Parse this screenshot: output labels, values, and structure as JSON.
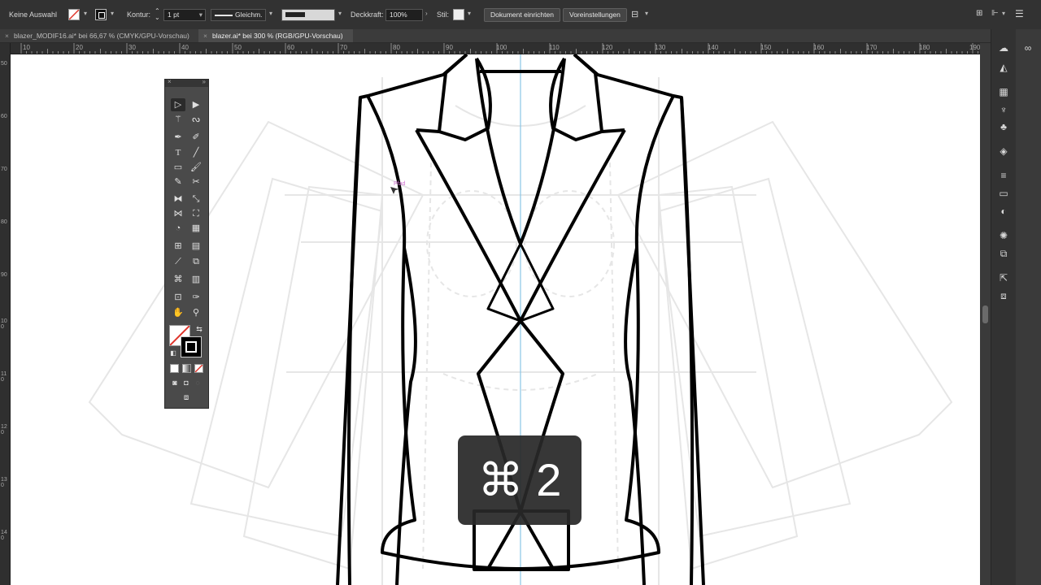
{
  "control_bar": {
    "selection_status": "Keine Auswahl",
    "stroke_label": "Kontur:",
    "stroke_weight": "1 pt",
    "stroke_profile": "Gleichm.",
    "opacity_label": "Deckkraft:",
    "opacity_value": "100%",
    "style_label": "Stil:",
    "document_setup_button": "Dokument einrichten",
    "preferences_button": "Voreinstellungen"
  },
  "tabs": [
    {
      "label": "blazer_MODIF16.ai* bei 66,67 % (CMYK/GPU-Vorschau)",
      "active": false
    },
    {
      "label": "blazer.ai* bei 300 % (RGB/GPU-Vorschau)",
      "active": true
    }
  ],
  "ruler": {
    "h_labels": [
      "10",
      "20",
      "30",
      "40",
      "50",
      "60",
      "70",
      "80",
      "90",
      "100",
      "110",
      "120",
      "130",
      "140",
      "150",
      "160",
      "170",
      "180",
      "190"
    ],
    "v_labels": [
      "50",
      "60",
      "70",
      "80",
      "90",
      "100",
      "110",
      "120",
      "130",
      "140"
    ]
  },
  "canvas": {
    "path_hint": "Pfad"
  },
  "hud": {
    "shortcut": "⌘ 2"
  },
  "colors": {
    "accent_guide": "#8ac6e6",
    "fill_none_slash": "#e0352b",
    "smart_guide": "#d070d0"
  },
  "right_panel_icons": [
    "libraries-icon",
    "color-guide-icon",
    "swatches-icon",
    "brushes-icon",
    "symbols-icon",
    "layers-icon",
    "align-icon",
    "transparency-icon",
    "appearance-icon",
    "graphic-styles-icon",
    "transform-icon",
    "export-icon",
    "artboards-icon"
  ]
}
